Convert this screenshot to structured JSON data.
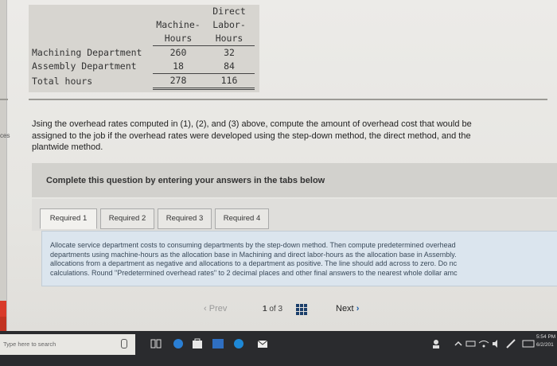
{
  "table": {
    "header": {
      "col1": [
        "Machine-",
        "Hours"
      ],
      "col2": [
        "Direct",
        "Labor-",
        "Hours"
      ]
    },
    "rows": [
      {
        "label": "Machining Department",
        "machine": "260",
        "labor": "32"
      },
      {
        "label": "Assembly Department",
        "machine": "18",
        "labor": "84"
      },
      {
        "label": "Total hours",
        "machine": "278",
        "labor": "116"
      }
    ]
  },
  "side_label": "ces",
  "question_text": "Jsing the overhead rates computed in (1), (2), and (3) above, compute the amount of overhead cost that would be assigned to the job if the overhead rates were developed using the step-down method, the direct method, and the plantwide method.",
  "question_lines": [
    "Jsing the overhead rates computed in (1), (2), and (3) above, compute the amount of overhead cost that would be",
    "assigned to the job if the overhead rates were developed using the step-down method, the direct method, and the",
    "plantwide method."
  ],
  "instructions": "Complete this question by entering your answers in the tabs below",
  "tabs": [
    "Required 1",
    "Required 2",
    "Required 3",
    "Required 4"
  ],
  "content_lines": [
    "Allocate service department costs to consuming departments by the step-down method. Then compute predetermined overhead",
    "departments using machine-hours as the allocation base in Machining and direct labor-hours as the allocation base in Assembly.",
    "allocations from a department as negative and allocations to a department as positive. The line should add across to zero. Do nc",
    "calculations. Round \"Predetermined overhead rates\" to 2 decimal places and other final answers to the nearest whole dollar amc"
  ],
  "pager": {
    "prev": "Prev",
    "page": "1",
    "of": "of",
    "total": "3",
    "next": "Next"
  },
  "taskbar": {
    "search_placeholder": "Type here to search",
    "time": "5:54 PM",
    "date": "6/2/201"
  },
  "colors": {
    "accent": "#1a5da8",
    "taskbar": "#2a2b2e",
    "content_bg": "#dbe5ee"
  }
}
